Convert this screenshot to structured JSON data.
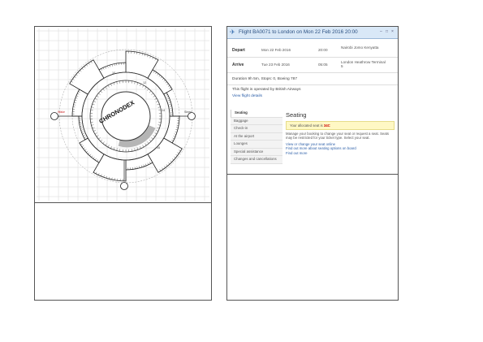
{
  "chart": {
    "center_label": "CHRONODEX",
    "ring_labels": [
      "10",
      "12",
      "14",
      "16"
    ],
    "side_labels": [
      "Wake",
      "Sleep"
    ]
  },
  "flight": {
    "title": "Flight BA0071 to London on Mon 22 Feb 2016 20:00",
    "controls": [
      "–",
      "□",
      "×"
    ],
    "depart": {
      "label": "Depart",
      "date": "Mon 22 Feb 2016",
      "time": "20:00",
      "place": "Nairobi Jomo Kenyatta"
    },
    "arrive": {
      "label": "Arrive",
      "date": "Tue 23 Feb 2016",
      "time": "05:05",
      "place": "London Heathrow Terminal 5"
    },
    "duration_note": "Duration 9h 5m, Stops: 0, Boeing 787",
    "operated_note": "This flight is operated by British Airways",
    "view_details": "View flight details"
  },
  "sidebar": {
    "items": [
      {
        "label": "Seating",
        "active": true
      },
      {
        "label": "Baggage",
        "active": false
      },
      {
        "label": "Check-in",
        "active": false
      },
      {
        "label": "At the airport",
        "active": false
      },
      {
        "label": "Lounges",
        "active": false
      },
      {
        "label": "Special assistance",
        "active": false
      },
      {
        "label": "Changes and cancellations",
        "active": false
      }
    ]
  },
  "seating": {
    "heading": "Seating",
    "warning_prefix": "Your allocated seat is",
    "warning_seat": "34C",
    "paragraph": "Manage your booking to change your seat or request a seat. Seats may be restricted for your ticket type. Select your seat.",
    "links": [
      "View or change your seat online",
      "Find out more about seating options on board",
      "Find out more"
    ]
  },
  "colors": {
    "titlebar_bg": "#d9e8f7",
    "link": "#2b5ea8",
    "warning_bg": "#fff8c4",
    "seat_highlight": "#cc0000"
  }
}
